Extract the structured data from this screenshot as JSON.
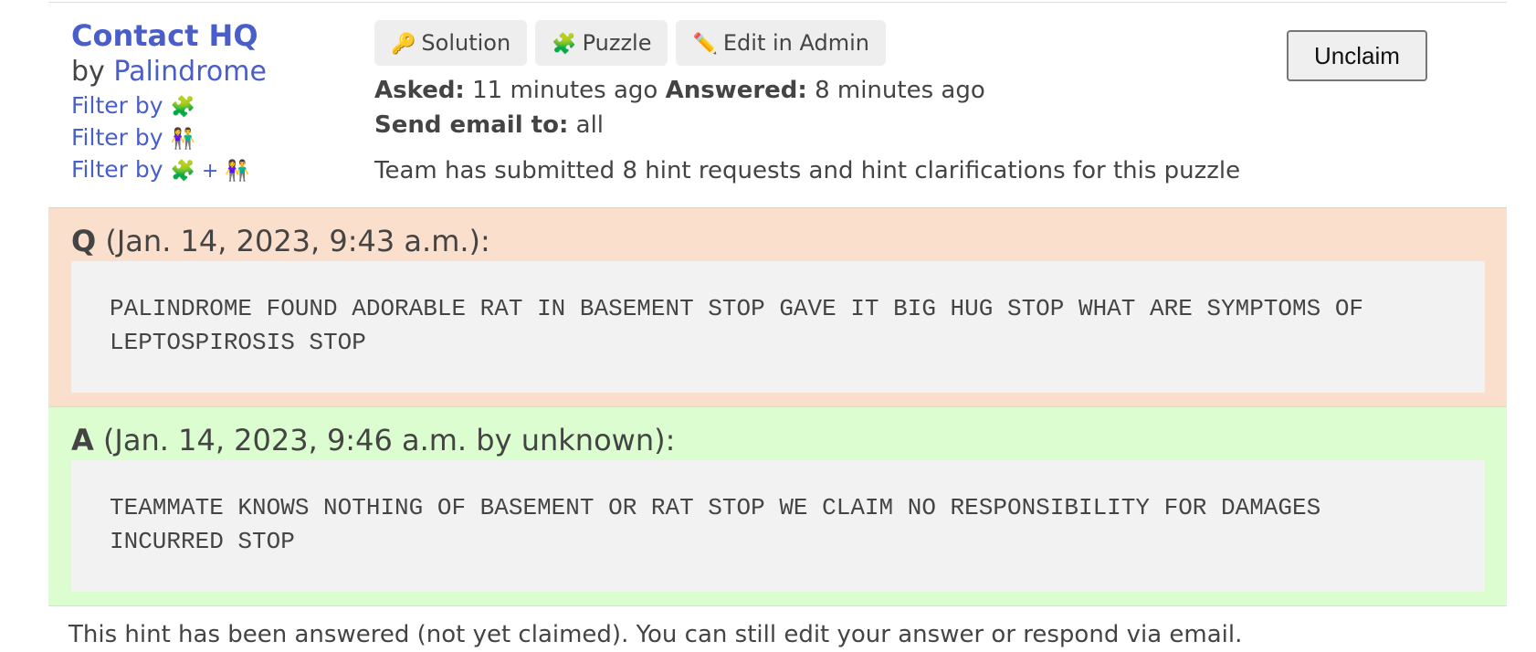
{
  "hint": {
    "puzzle_title": "Contact HQ",
    "by_prefix": "by",
    "team_name": "Palindrome",
    "filters": [
      {
        "label": "Filter by",
        "icons": "🧩"
      },
      {
        "label": "Filter by",
        "icons": "👫"
      },
      {
        "label": "Filter by",
        "icons": "🧩 + 👫"
      }
    ],
    "buttons": [
      {
        "icon": "🔑",
        "label": "Solution"
      },
      {
        "icon": "🧩",
        "label": "Puzzle"
      },
      {
        "icon": "✏️",
        "label": "Edit in Admin"
      }
    ],
    "asked_label": "Asked:",
    "asked_value": "11 minutes ago",
    "answered_label": "Answered:",
    "answered_value": "8 minutes ago",
    "email_label": "Send email to:",
    "email_value": "all",
    "hint_count_text": "Team has submitted 8 hint requests and hint clarifications for this puzzle",
    "unclaim_label": "Unclaim"
  },
  "question": {
    "marker": "Q",
    "meta": "(Jan. 14, 2023, 9:43 a.m.):",
    "text": "PALINDROME FOUND ADORABLE RAT IN BASEMENT STOP GAVE IT BIG HUG STOP WHAT ARE SYMPTOMS OF LEPTOSPIROSIS STOP"
  },
  "answer": {
    "marker": "A",
    "meta": "(Jan. 14, 2023, 9:46 a.m. by unknown):",
    "text": "TEAMMATE KNOWS NOTHING OF BASEMENT OR RAT STOP WE CLAIM NO RESPONSIBILITY FOR DAMAGES INCURRED STOP"
  },
  "footer": {
    "text": "This hint has been answered (not yet claimed). You can still edit your answer or respond via email."
  },
  "colors": {
    "link": "#4a5ec9",
    "question_bg": "#fadfcc",
    "answer_bg": "#dbfdd0",
    "message_bg": "#f2f2f2"
  }
}
